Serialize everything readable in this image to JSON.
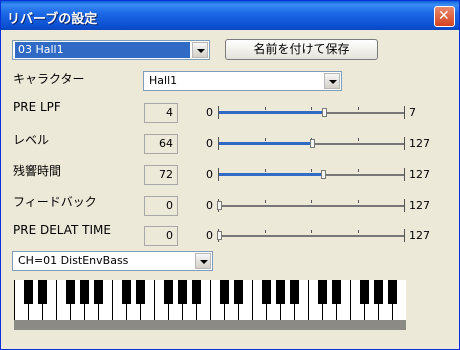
{
  "window": {
    "title": "リバーブの設定",
    "close_label": "✕"
  },
  "preset": {
    "selected": "03 Hall1"
  },
  "save_button": "名前を付けて保存",
  "character": {
    "label": "キャラクター",
    "selected": "Hall1"
  },
  "params": [
    {
      "label": "PRE LPF",
      "value": "4",
      "min": "0",
      "max": "7",
      "level": 0.5714
    },
    {
      "label": "レベル",
      "value": "64",
      "min": "0",
      "max": "127",
      "level": 0.5039
    },
    {
      "label": "残響時間",
      "value": "72",
      "min": "0",
      "max": "127",
      "level": 0.5669
    },
    {
      "label": "フィードバック",
      "value": "0",
      "min": "0",
      "max": "127",
      "level": 0
    },
    {
      "label": "PRE DELAT TIME",
      "value": "0",
      "min": "0",
      "max": "127",
      "level": 0
    }
  ],
  "channel": {
    "selected": "CH=01 DistEnvBass"
  }
}
